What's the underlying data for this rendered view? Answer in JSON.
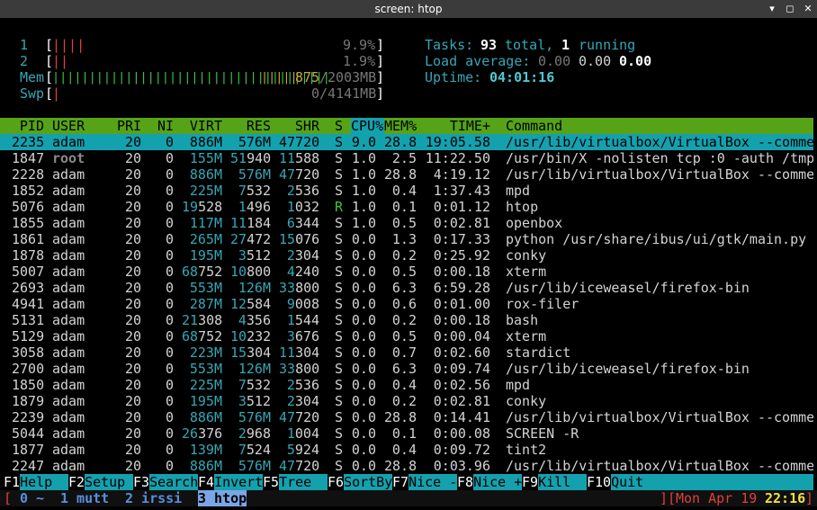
{
  "window": {
    "title": "screen: htop",
    "minimize_glyph": "▾",
    "maximize_glyph": "✕",
    "restore_glyph": "◻",
    "close_glyph": "✕"
  },
  "meters": {
    "cpu1": {
      "label": "1",
      "bars": "||||",
      "value": "9.9%"
    },
    "cpu2": {
      "label": "2",
      "bars": "||",
      "value": "1.9%"
    },
    "mem": {
      "label": "Mem",
      "bars_green": "||||||||||||||||||||||||||||||||||||||",
      "bars_yellow": "|||||",
      "used": "875",
      "total": "/2003MB"
    },
    "swp": {
      "label": "Swp",
      "bars": "|",
      "value": "0/4141MB"
    }
  },
  "stats": {
    "tasks_label": "Tasks:",
    "tasks_total": "93",
    "total_label": "total,",
    "tasks_running": "1",
    "running_label": "running",
    "load_label": "Load average:",
    "load1": "0.00",
    "load5": "0.00",
    "load15": "0.00",
    "uptime_label": "Uptime:",
    "uptime": "04:01:16"
  },
  "columns": [
    "PID",
    "USER",
    "PRI",
    "NI",
    "VIRT",
    "RES",
    "SHR",
    "S",
    "CPU%",
    "MEM%",
    "TIME+",
    "Command"
  ],
  "processes": [
    {
      "pid": "2235",
      "user": "adam",
      "pri": "20",
      "ni": "0",
      "virt": "886M",
      "res": "576M",
      "shr": "47720",
      "s": "S",
      "cpu": "9.0",
      "mem": "28.8",
      "time": "19:05.58",
      "cmd": "/usr/lib/virtualbox/VirtualBox --comme"
    },
    {
      "pid": "1847",
      "user": "root",
      "pri": "20",
      "ni": "0",
      "virt": "155M",
      "res": "51940",
      "shr": "11588",
      "s": "S",
      "cpu": "1.0",
      "mem": "2.5",
      "time": "11:22.50",
      "cmd": "/usr/bin/X -nolisten tcp :0 -auth /tmp"
    },
    {
      "pid": "2228",
      "user": "adam",
      "pri": "20",
      "ni": "0",
      "virt": "886M",
      "res": "576M",
      "shr": "47720",
      "s": "S",
      "cpu": "1.0",
      "mem": "28.8",
      "time": "4:19.12",
      "cmd": "/usr/lib/virtualbox/VirtualBox --comme"
    },
    {
      "pid": "1852",
      "user": "adam",
      "pri": "20",
      "ni": "0",
      "virt": "225M",
      "res": "7532",
      "shr": "2536",
      "s": "S",
      "cpu": "1.0",
      "mem": "0.4",
      "time": "1:37.43",
      "cmd": "mpd"
    },
    {
      "pid": "5076",
      "user": "adam",
      "pri": "20",
      "ni": "0",
      "virt": "19528",
      "res": "1496",
      "shr": "1032",
      "s": "R",
      "cpu": "1.0",
      "mem": "0.1",
      "time": "0:01.12",
      "cmd": "htop"
    },
    {
      "pid": "1855",
      "user": "adam",
      "pri": "20",
      "ni": "0",
      "virt": "117M",
      "res": "11184",
      "shr": "6344",
      "s": "S",
      "cpu": "1.0",
      "mem": "0.5",
      "time": "0:02.81",
      "cmd": "openbox"
    },
    {
      "pid": "1861",
      "user": "adam",
      "pri": "20",
      "ni": "0",
      "virt": "265M",
      "res": "27472",
      "shr": "15076",
      "s": "S",
      "cpu": "0.0",
      "mem": "1.3",
      "time": "0:17.33",
      "cmd": "python /usr/share/ibus/ui/gtk/main.py"
    },
    {
      "pid": "1878",
      "user": "adam",
      "pri": "20",
      "ni": "0",
      "virt": "195M",
      "res": "3512",
      "shr": "2304",
      "s": "S",
      "cpu": "0.0",
      "mem": "0.2",
      "time": "0:25.92",
      "cmd": "conky"
    },
    {
      "pid": "5007",
      "user": "adam",
      "pri": "20",
      "ni": "0",
      "virt": "68752",
      "res": "10800",
      "shr": "4240",
      "s": "S",
      "cpu": "0.0",
      "mem": "0.5",
      "time": "0:00.18",
      "cmd": "xterm"
    },
    {
      "pid": "2693",
      "user": "adam",
      "pri": "20",
      "ni": "0",
      "virt": "553M",
      "res": "126M",
      "shr": "33800",
      "s": "S",
      "cpu": "0.0",
      "mem": "6.3",
      "time": "6:59.28",
      "cmd": "/usr/lib/iceweasel/firefox-bin"
    },
    {
      "pid": "4941",
      "user": "adam",
      "pri": "20",
      "ni": "0",
      "virt": "287M",
      "res": "12584",
      "shr": "9008",
      "s": "S",
      "cpu": "0.0",
      "mem": "0.6",
      "time": "0:01.00",
      "cmd": "rox-filer"
    },
    {
      "pid": "5131",
      "user": "adam",
      "pri": "20",
      "ni": "0",
      "virt": "21308",
      "res": "4356",
      "shr": "1544",
      "s": "S",
      "cpu": "0.0",
      "mem": "0.2",
      "time": "0:00.18",
      "cmd": "bash"
    },
    {
      "pid": "5129",
      "user": "adam",
      "pri": "20",
      "ni": "0",
      "virt": "68752",
      "res": "10232",
      "shr": "3676",
      "s": "S",
      "cpu": "0.0",
      "mem": "0.5",
      "time": "0:00.04",
      "cmd": "xterm"
    },
    {
      "pid": "3058",
      "user": "adam",
      "pri": "20",
      "ni": "0",
      "virt": "223M",
      "res": "15304",
      "shr": "11304",
      "s": "S",
      "cpu": "0.0",
      "mem": "0.7",
      "time": "0:02.60",
      "cmd": "stardict"
    },
    {
      "pid": "2700",
      "user": "adam",
      "pri": "20",
      "ni": "0",
      "virt": "553M",
      "res": "126M",
      "shr": "33800",
      "s": "S",
      "cpu": "0.0",
      "mem": "6.3",
      "time": "0:09.74",
      "cmd": "/usr/lib/iceweasel/firefox-bin"
    },
    {
      "pid": "1850",
      "user": "adam",
      "pri": "20",
      "ni": "0",
      "virt": "225M",
      "res": "7532",
      "shr": "2536",
      "s": "S",
      "cpu": "0.0",
      "mem": "0.4",
      "time": "0:02.56",
      "cmd": "mpd"
    },
    {
      "pid": "1879",
      "user": "adam",
      "pri": "20",
      "ni": "0",
      "virt": "195M",
      "res": "3512",
      "shr": "2304",
      "s": "S",
      "cpu": "0.0",
      "mem": "0.2",
      "time": "0:02.81",
      "cmd": "conky"
    },
    {
      "pid": "2239",
      "user": "adam",
      "pri": "20",
      "ni": "0",
      "virt": "886M",
      "res": "576M",
      "shr": "47720",
      "s": "S",
      "cpu": "0.0",
      "mem": "28.8",
      "time": "0:14.41",
      "cmd": "/usr/lib/virtualbox/VirtualBox --comme"
    },
    {
      "pid": "5044",
      "user": "adam",
      "pri": "20",
      "ni": "0",
      "virt": "26376",
      "res": "2968",
      "shr": "1004",
      "s": "S",
      "cpu": "0.0",
      "mem": "0.1",
      "time": "0:00.08",
      "cmd": "SCREEN -R"
    },
    {
      "pid": "1877",
      "user": "adam",
      "pri": "20",
      "ni": "0",
      "virt": "139M",
      "res": "7524",
      "shr": "5924",
      "s": "S",
      "cpu": "0.0",
      "mem": "0.4",
      "time": "0:09.72",
      "cmd": "tint2"
    },
    {
      "pid": "2247",
      "user": "adam",
      "pri": "20",
      "ni": "0",
      "virt": "886M",
      "res": "576M",
      "shr": "47720",
      "s": "S",
      "cpu": "0.0",
      "mem": "28.8",
      "time": "0:03.96",
      "cmd": "/usr/lib/virtualbox/VirtualBox --comme"
    }
  ],
  "fkeys": [
    {
      "key": "F1",
      "label": "Help  "
    },
    {
      "key": "F2",
      "label": "Setup "
    },
    {
      "key": "F3",
      "label": "Search"
    },
    {
      "key": "F4",
      "label": "Invert"
    },
    {
      "key": "F5",
      "label": "Tree  "
    },
    {
      "key": "F6",
      "label": "SortBy"
    },
    {
      "key": "F7",
      "label": "Nice -"
    },
    {
      "key": "F8",
      "label": "Nice +"
    },
    {
      "key": "F9",
      "label": "Kill  "
    },
    {
      "key": "F10",
      "label": "Quit  "
    }
  ],
  "screenbar": {
    "open": "[ ",
    "w0": "0 ~",
    "w1": "1 mutt",
    "w2": "2 irssi",
    "w3": "3 htop",
    "close_open": "][",
    "date": "Mon Apr 19 ",
    "time": "22:16",
    "end": "]"
  }
}
